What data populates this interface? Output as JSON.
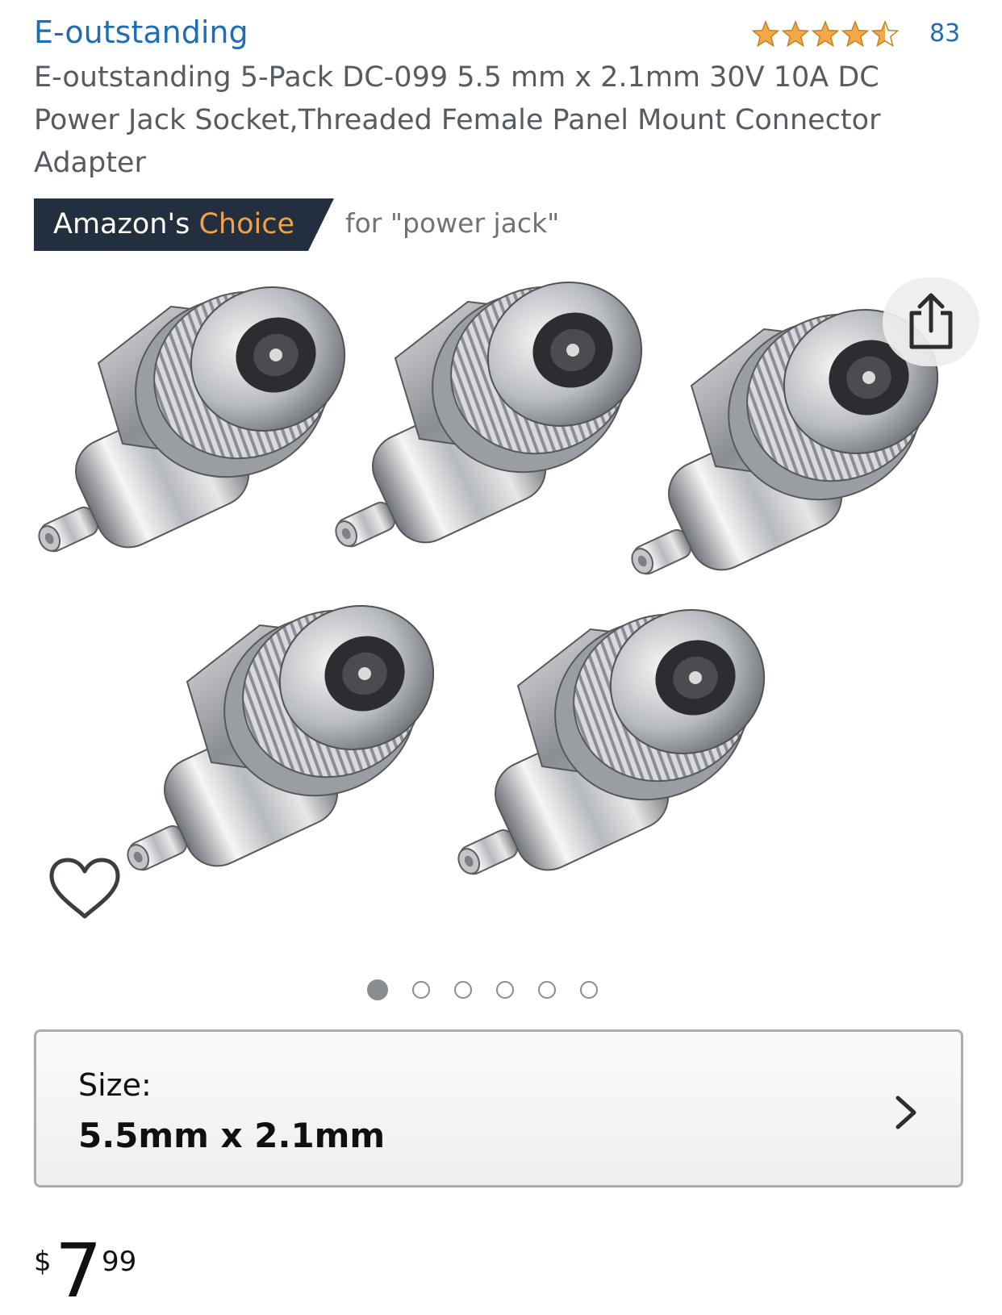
{
  "header": {
    "brand": "E-outstanding",
    "rating": {
      "stars": 4.5,
      "count": "83"
    },
    "title": "E-outstanding 5-Pack DC-099 5.5 mm x 2.1mm 30V 10A DC Power Jack Socket,Threaded Female Panel Mount Connector Adapter"
  },
  "badge": {
    "prefix": "Amazon's",
    "choice": "Choice",
    "context": "for \"power jack\""
  },
  "gallery": {
    "icons": {
      "share": "share-icon",
      "wishlist": "heart-icon"
    },
    "dot_count": 6,
    "active_index": 0
  },
  "size_selector": {
    "label": "Size:",
    "value": "5.5mm x 2.1mm"
  },
  "price": {
    "symbol": "$",
    "whole": "7",
    "fraction": "99"
  },
  "colors": {
    "link": "#1f6db3",
    "badge_bg": "#232f3e",
    "badge_accent": "#f0a14a",
    "star": "#f3a847"
  }
}
